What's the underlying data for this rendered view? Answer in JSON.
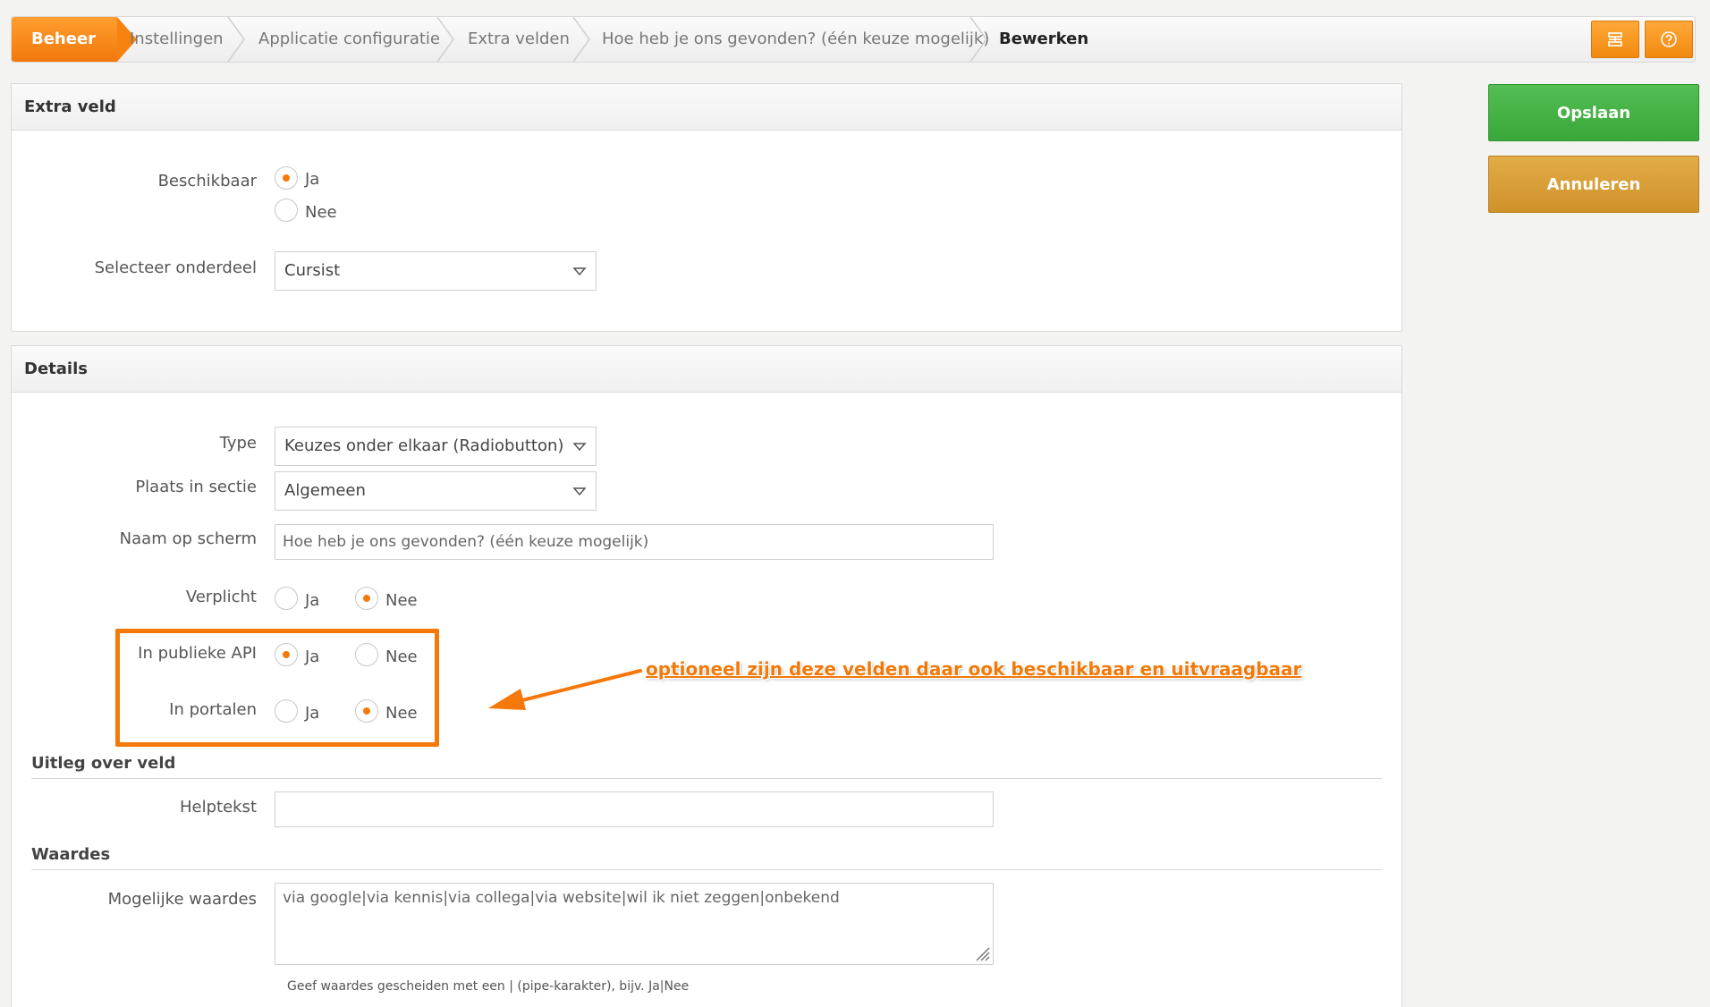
{
  "breadcrumb": {
    "home": "Beheer",
    "items": [
      "Instellingen",
      "Applicatie configuratie",
      "Extra velden",
      "Hoe heb je ons gevonden? (één keuze mogelijk)"
    ],
    "current": "Bewerken",
    "accent": "#f47a0b"
  },
  "toolbar_icons": [
    "panel-icon",
    "help-icon"
  ],
  "actions": {
    "save": "Opslaan",
    "cancel": "Annuleren"
  },
  "section_extra": {
    "title": "Extra veld",
    "available": {
      "label": "Beschikbaar",
      "yes": "Ja",
      "no": "Nee",
      "selected": "Ja"
    },
    "part": {
      "label": "Selecteer onderdeel",
      "value": "Cursist"
    }
  },
  "section_details": {
    "title": "Details",
    "type": {
      "label": "Type",
      "value": "Keuzes onder elkaar (Radiobutton)"
    },
    "place": {
      "label": "Plaats in sectie",
      "value": "Algemeen"
    },
    "screen_name": {
      "label": "Naam op scherm",
      "value": "Hoe heb je ons gevonden? (één keuze mogelijk)"
    },
    "required": {
      "label": "Verplicht",
      "yes": "Ja",
      "no": "Nee",
      "selected": "Nee"
    },
    "public_api": {
      "label": "In publieke API",
      "yes": "Ja",
      "no": "Nee",
      "selected": "Ja"
    },
    "portals": {
      "label": "In portalen",
      "yes": "Ja",
      "no": "Nee",
      "selected": "Nee"
    },
    "explain_heading": "Uitleg over veld",
    "helptext": {
      "label": "Helptekst",
      "value": ""
    },
    "values_heading": "Waardes",
    "possible_values": {
      "label": "Mogelijke waardes",
      "value": "via google|via kennis|via collega|via website|wil ik niet zeggen|onbekend"
    },
    "hint": "Geef waardes gescheiden met een | (pipe-karakter), bijv. Ja|Nee"
  },
  "annotation": {
    "text": "optioneel zijn deze velden daar ook beschikbaar en uitvraagbaar",
    "color": "#f5780a"
  }
}
